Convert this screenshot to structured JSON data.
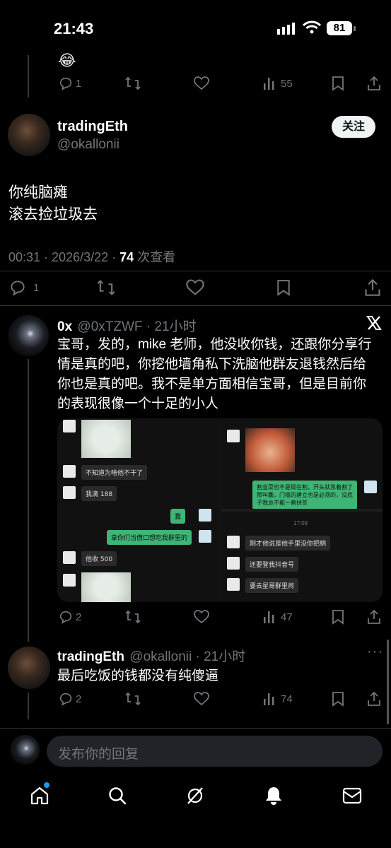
{
  "status": {
    "time": "21:43",
    "battery": "81"
  },
  "top_actions": {
    "replies": "1",
    "views": "55"
  },
  "emoji_top": "😂",
  "main_tweet": {
    "display_name": "tradingEth",
    "handle": "@okallonii",
    "follow_label": "关注",
    "line1": "你纯脑瘫",
    "line2": "滚去捡垃圾去",
    "meta_time": "00:31 · 2026/3/22 · ",
    "meta_views": "74",
    "meta_views_label": " 次查看",
    "replies": "1"
  },
  "reply1": {
    "display_name": "0x",
    "handle_time": "@0xTZWF · 21小时",
    "text": "宝哥，发的，mike 老师，他没收你钱，还跟你分享行情是真的吧，你挖他墙角私下洗脑他群友退钱然后给你也是真的吧。我不是单方面相信宝哥，但是目前你的表现很像一个十足的小人",
    "replies": "2",
    "views": "47",
    "chat_left": [
      "不知道为啥他不干了",
      "我滴 188",
      "蠢",
      "拿你们当借口想吃我群里的",
      "他收 500"
    ],
    "chat_right": [
      "割韭菜也不是现在割。开头就急着割了那叫蠢，门槛的建立也是必须的，没底子我总不能一直扶贫",
      "17:09",
      "刚才他说是他手里没你把柄",
      "还要登我抖音号",
      "要去星哥群里闹"
    ]
  },
  "reply2": {
    "display_name": "tradingEth",
    "handle_time": "@okallonii · 21小时",
    "text": "最后吃饭的钱都没有纯傻逼",
    "replies": "2",
    "views": "74"
  },
  "composer": {
    "placeholder": "发布你的回复"
  },
  "colors": {
    "background": "#000000",
    "text": "#e7e9ea",
    "muted": "#71767b",
    "accent": "#1d9bf0",
    "wechat_green": "#3eb575"
  },
  "icons": [
    "reply-icon",
    "retweet-icon",
    "like-icon",
    "views-icon",
    "bookmark-icon",
    "share-icon",
    "x-logo-icon",
    "home-icon",
    "search-icon",
    "grok-icon",
    "notifications-icon",
    "messages-icon"
  ]
}
